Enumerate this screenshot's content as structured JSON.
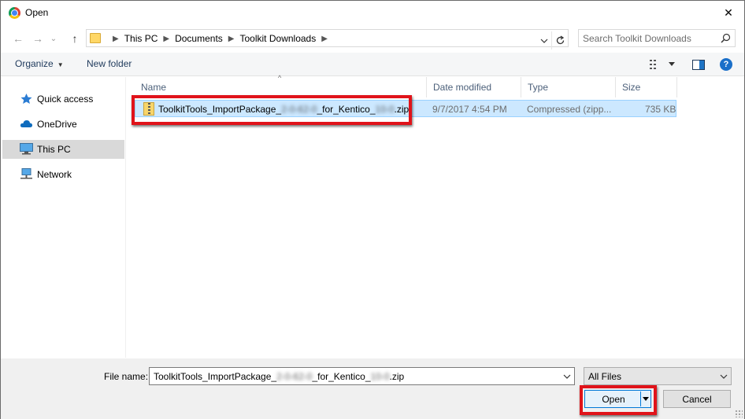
{
  "window": {
    "title": "Open",
    "close_glyph": "✕"
  },
  "navigation": {
    "back_glyph": "←",
    "forward_glyph": "→",
    "recent_glyph": "⌄",
    "up_glyph": "↑",
    "breadcrumb": [
      "This PC",
      "Documents",
      "Toolkit Downloads"
    ],
    "search_placeholder": "Search Toolkit Downloads"
  },
  "toolbar": {
    "organize_label": "Organize",
    "new_folder_label": "New folder",
    "help_glyph": "?"
  },
  "sidebar": {
    "items": [
      {
        "label": "Quick access",
        "icon": "star-icon"
      },
      {
        "label": "OneDrive",
        "icon": "cloud-icon"
      },
      {
        "label": "This PC",
        "icon": "computer-icon",
        "selected": true
      },
      {
        "label": "Network",
        "icon": "network-icon"
      }
    ]
  },
  "file_list": {
    "columns": [
      "Name",
      "Date modified",
      "Type",
      "Size"
    ],
    "sort_glyph": "^",
    "rows": [
      {
        "name_prefix": "ToolkitTools_ImportPackage_",
        "name_blur_1": "2-0-62-0",
        "name_mid": "_for_Kentico_",
        "name_blur_2": "10-0",
        "name_suffix": ".zip",
        "date_modified": "9/7/2017 4:54 PM",
        "type": "Compressed (zipp...",
        "size": "735 KB",
        "icon": "zip-folder-icon",
        "selected": true
      }
    ]
  },
  "footer": {
    "file_name_label": "File name:",
    "file_name_prefix": "ToolkitTools_ImportPackage_",
    "file_name_blur_1": "2-0-62-0",
    "file_name_mid": "_for_Kentico_",
    "file_name_blur_2": "10-0",
    "file_name_suffix": ".zip",
    "file_type": "All Files",
    "open_label": "Open",
    "cancel_label": "Cancel"
  },
  "colors": {
    "highlight_red": "#e0131a",
    "selection_blue": "#cce8ff",
    "accent_blue": "#0078d7"
  }
}
